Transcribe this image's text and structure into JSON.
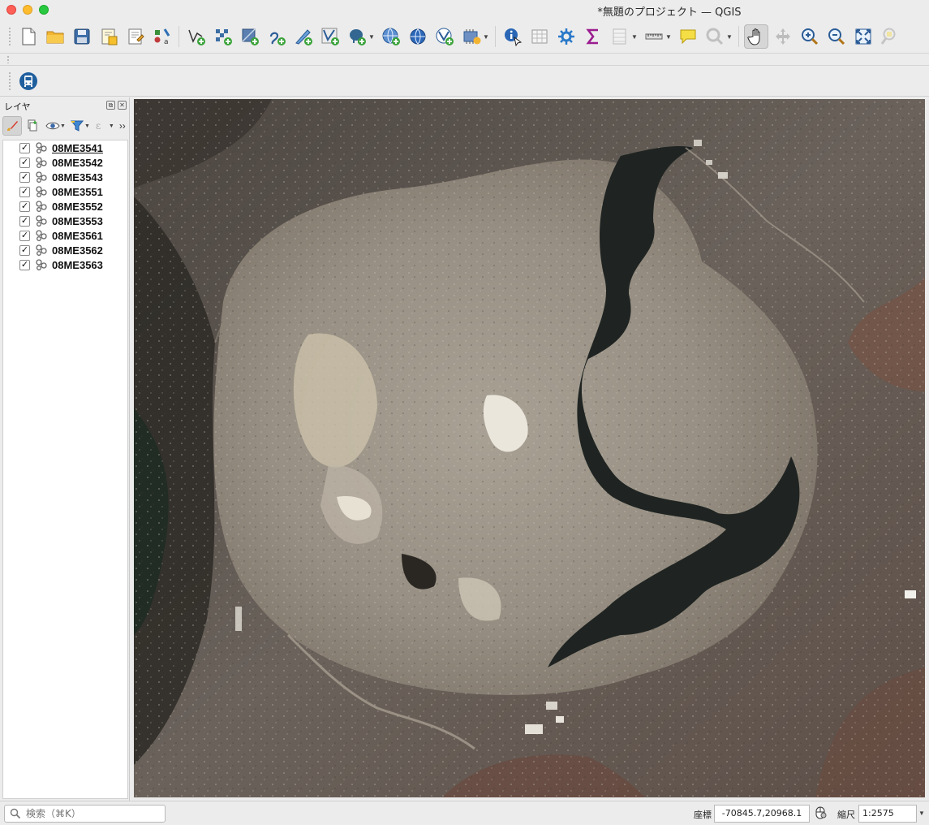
{
  "window": {
    "title": "*無題のプロジェクト — QGIS"
  },
  "layers_panel": {
    "title": "レイヤ",
    "layers": [
      {
        "name": "08ME3541",
        "checked": "✓",
        "selected": true
      },
      {
        "name": "08ME3542",
        "checked": "✓"
      },
      {
        "name": "08ME3543",
        "checked": "✓"
      },
      {
        "name": "08ME3551",
        "checked": "✓"
      },
      {
        "name": "08ME3552",
        "checked": "✓"
      },
      {
        "name": "08ME3553",
        "checked": "✓"
      },
      {
        "name": "08ME3561",
        "checked": "✓"
      },
      {
        "name": "08ME3562",
        "checked": "✓"
      },
      {
        "name": "08ME3563",
        "checked": "✓"
      }
    ]
  },
  "statusbar": {
    "search_placeholder": "検索（⌘K）",
    "coord_label": "座標",
    "coord_value": "-70845.7,20968.1",
    "scale_label": "縮尺",
    "scale_value": "1:2575"
  },
  "colors": {
    "accent": "#1e6fd9",
    "map_dark_lava": "#1f2422",
    "map_light_crater": "#a39a8e"
  }
}
